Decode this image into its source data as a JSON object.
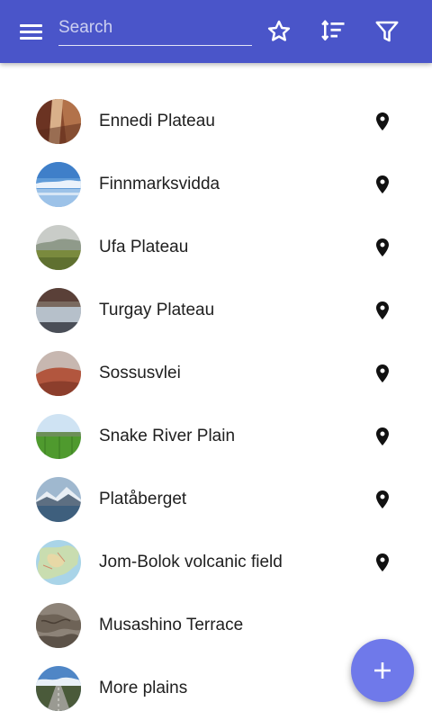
{
  "app": {
    "colors": {
      "appbar": "#4a55c9",
      "fab": "#6f79ea",
      "text": "#202020",
      "icon_on_bar": "#ffffff"
    }
  },
  "toolbar": {
    "menu_icon": "menu-icon",
    "search": {
      "placeholder": "Search",
      "value": ""
    },
    "favorite_icon": "star-outline-icon",
    "sort_icon": "sort-icon",
    "filter_icon": "filter-icon"
  },
  "list": {
    "items": [
      {
        "label": "Ennedi Plateau",
        "thumb": "canyon-rock-image",
        "has_location": true
      },
      {
        "label": "Finnmarksvidda",
        "thumb": "snowy-sky-image",
        "has_location": true
      },
      {
        "label": "Ufa Plateau",
        "thumb": "misty-meadow-image",
        "has_location": true
      },
      {
        "label": "Turgay Plateau",
        "thumb": "water-reflection-image",
        "has_location": true
      },
      {
        "label": "Sossusvlei",
        "thumb": "red-dunes-image",
        "has_location": true
      },
      {
        "label": "Snake River Plain",
        "thumb": "green-field-image",
        "has_location": true
      },
      {
        "label": "Platåberget",
        "thumb": "mountain-fjord-image",
        "has_location": true
      },
      {
        "label": "Jom-Bolok volcanic field",
        "thumb": "map-image",
        "has_location": true
      },
      {
        "label": "Musashino Terrace",
        "thumb": "relief-map-image",
        "has_location": false
      },
      {
        "label": "More plains",
        "thumb": "road-landscape-image",
        "has_location": false
      }
    ]
  },
  "fab": {
    "icon": "plus-icon"
  }
}
